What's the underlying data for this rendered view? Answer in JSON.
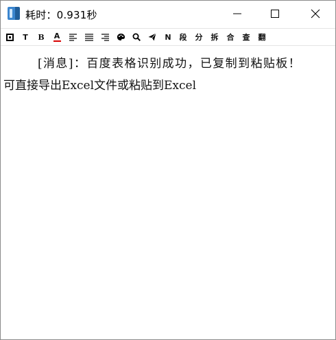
{
  "window": {
    "title": "耗时：0.931秒"
  },
  "toolbar": {
    "items": [
      {
        "name": "frame-icon",
        "label": ""
      },
      {
        "name": "text-icon",
        "label": "T"
      },
      {
        "name": "bold-icon",
        "label": "B"
      },
      {
        "name": "font-color-icon",
        "label": "A"
      },
      {
        "name": "align-left-icon",
        "label": ""
      },
      {
        "name": "align-justify-icon",
        "label": ""
      },
      {
        "name": "align-right-icon",
        "label": ""
      },
      {
        "name": "palette-icon",
        "label": ""
      },
      {
        "name": "search-icon",
        "label": ""
      },
      {
        "name": "send-icon",
        "label": ""
      },
      {
        "name": "n-icon",
        "label": "N"
      },
      {
        "name": "paragraph-button",
        "label": "段"
      },
      {
        "name": "split-button",
        "label": "分"
      },
      {
        "name": "disassemble-button",
        "label": "拆"
      },
      {
        "name": "merge-button",
        "label": "合"
      },
      {
        "name": "lookup-button",
        "label": "查"
      },
      {
        "name": "translate-button",
        "label": "翻"
      }
    ],
    "accent_color": "#d80000"
  },
  "content": {
    "line1": "[消息]：百度表格识别成功，已复制到粘贴板！",
    "line2": "可直接导出Excel文件或粘贴到Excel"
  }
}
